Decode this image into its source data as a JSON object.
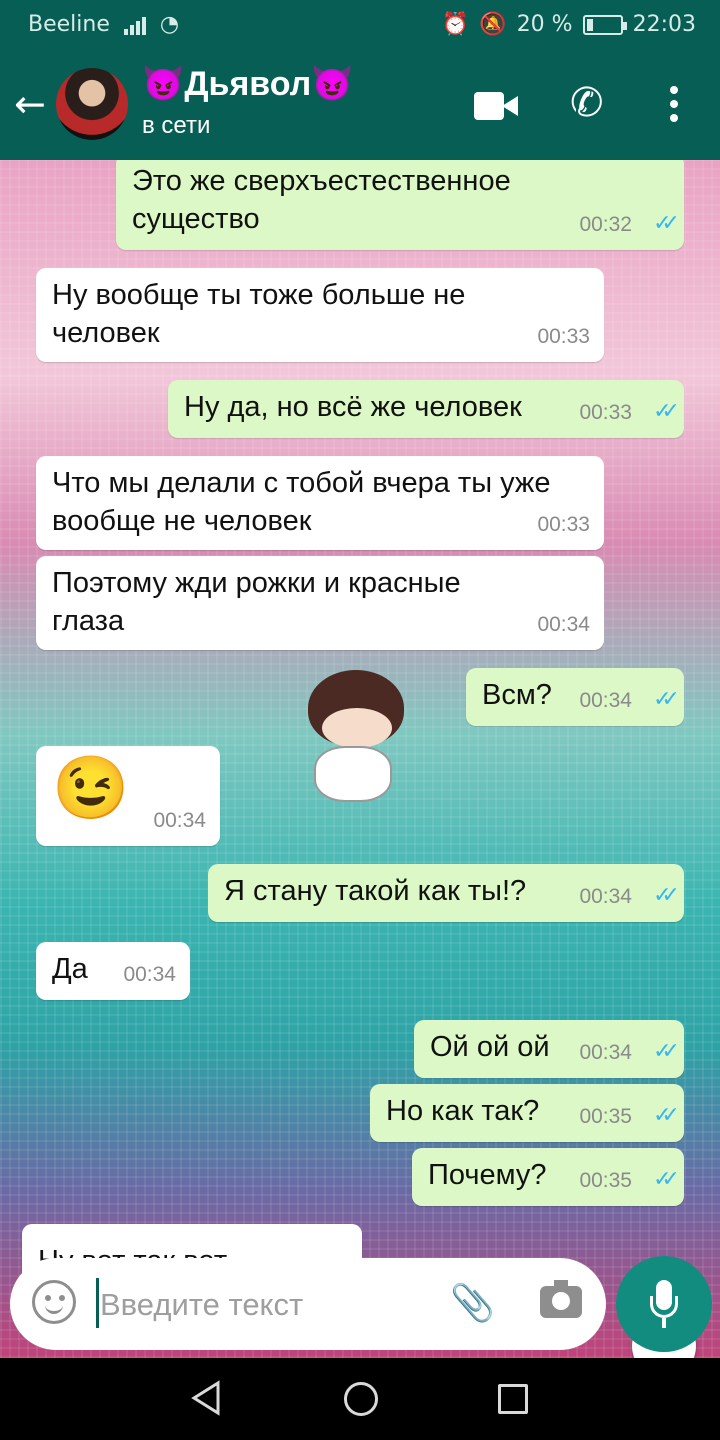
{
  "statusbar": {
    "carrier": "Beeline",
    "battery": "20 %",
    "battery_level": 0.2,
    "time": "22:03"
  },
  "header": {
    "back_icon": "arrow-left-icon",
    "name": "😈Дьявол😈",
    "status": "в сети",
    "video_icon": "video-call-icon",
    "phone_icon": "phone-icon",
    "menu_icon": "more-vert-icon"
  },
  "messages": [
    {
      "dir": "out",
      "text": "Это же сверхъестественное существо",
      "time": "00:32",
      "read": true
    },
    {
      "dir": "in",
      "text": "Ну вообще ты тоже больше не человек",
      "time": "00:33"
    },
    {
      "dir": "out",
      "text": "Ну да, но всё же человек",
      "time": "00:33",
      "read": true
    },
    {
      "dir": "in",
      "text": "Что мы делали с тобой вчера ты уже вообще не человек",
      "time": "00:33"
    },
    {
      "dir": "in",
      "text": "Поэтому жди рожки и красные глаза",
      "time": "00:34"
    },
    {
      "dir": "out",
      "text": "Всм?",
      "time": "00:34",
      "read": true
    },
    {
      "dir": "in",
      "type": "sticker",
      "sticker": "crying-baby-sticker"
    },
    {
      "dir": "in",
      "text": "😉",
      "time": "00:34"
    },
    {
      "dir": "out",
      "text": "Я стану такой как ты!?",
      "time": "00:34",
      "read": true
    },
    {
      "dir": "in",
      "text": "Да",
      "time": "00:34"
    },
    {
      "dir": "out",
      "text": "Ой ой ой",
      "time": "00:34",
      "read": true
    },
    {
      "dir": "out",
      "text": "Но как так?",
      "time": "00:35",
      "read": true
    },
    {
      "dir": "out",
      "text": "Почему?",
      "time": "00:35",
      "read": true
    },
    {
      "dir": "in",
      "text": "Ну вот так вот",
      "time": ""
    }
  ],
  "read_check": "✓✓",
  "scroll_down_icon": "chevron-double-down-icon",
  "input": {
    "placeholder": "Введите текст",
    "emoji_icon": "emoji-icon",
    "attach_icon": "paperclip-icon",
    "camera_icon": "camera-icon",
    "mic_icon": "mic-icon"
  },
  "colors": {
    "header": "#075E54",
    "outgoing_bubble": "#dcf8c6",
    "incoming_bubble": "#ffffff",
    "read_check": "#34b7f1",
    "mic_button": "#128C7E"
  }
}
